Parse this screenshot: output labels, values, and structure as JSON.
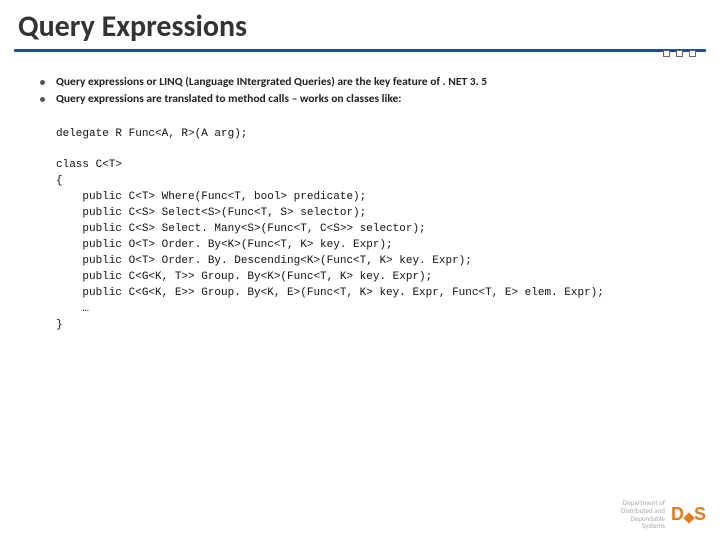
{
  "title": "Query Expressions",
  "bullets": [
    "Query expressions or LINQ (Language INtergrated Queries) are the key feature of . NET 3. 5",
    "Query expressions are translated to method calls – works on classes like:"
  ],
  "code": "delegate R Func<A, R>(A arg);\n\nclass C<T>\n{\n    public C<T> Where(Func<T, bool> predicate);\n    public C<S> Select<S>(Func<T, S> selector);\n    public C<S> Select. Many<S>(Func<T, C<S>> selector);\n    public O<T> Order. By<K>(Func<T, K> key. Expr);\n    public O<T> Order. By. Descending<K>(Func<T, K> key. Expr);\n    public C<G<K, T>> Group. By<K>(Func<T, K> key. Expr);\n    public C<G<K, E>> Group. By<K, E>(Func<T, K> key. Expr, Func<T, E> elem. Expr);\n    …\n}",
  "footer": {
    "dept_line1": "Department of",
    "dept_line2": "Distributed and",
    "dept_line3": "Dependable",
    "dept_line4": "Systems"
  }
}
